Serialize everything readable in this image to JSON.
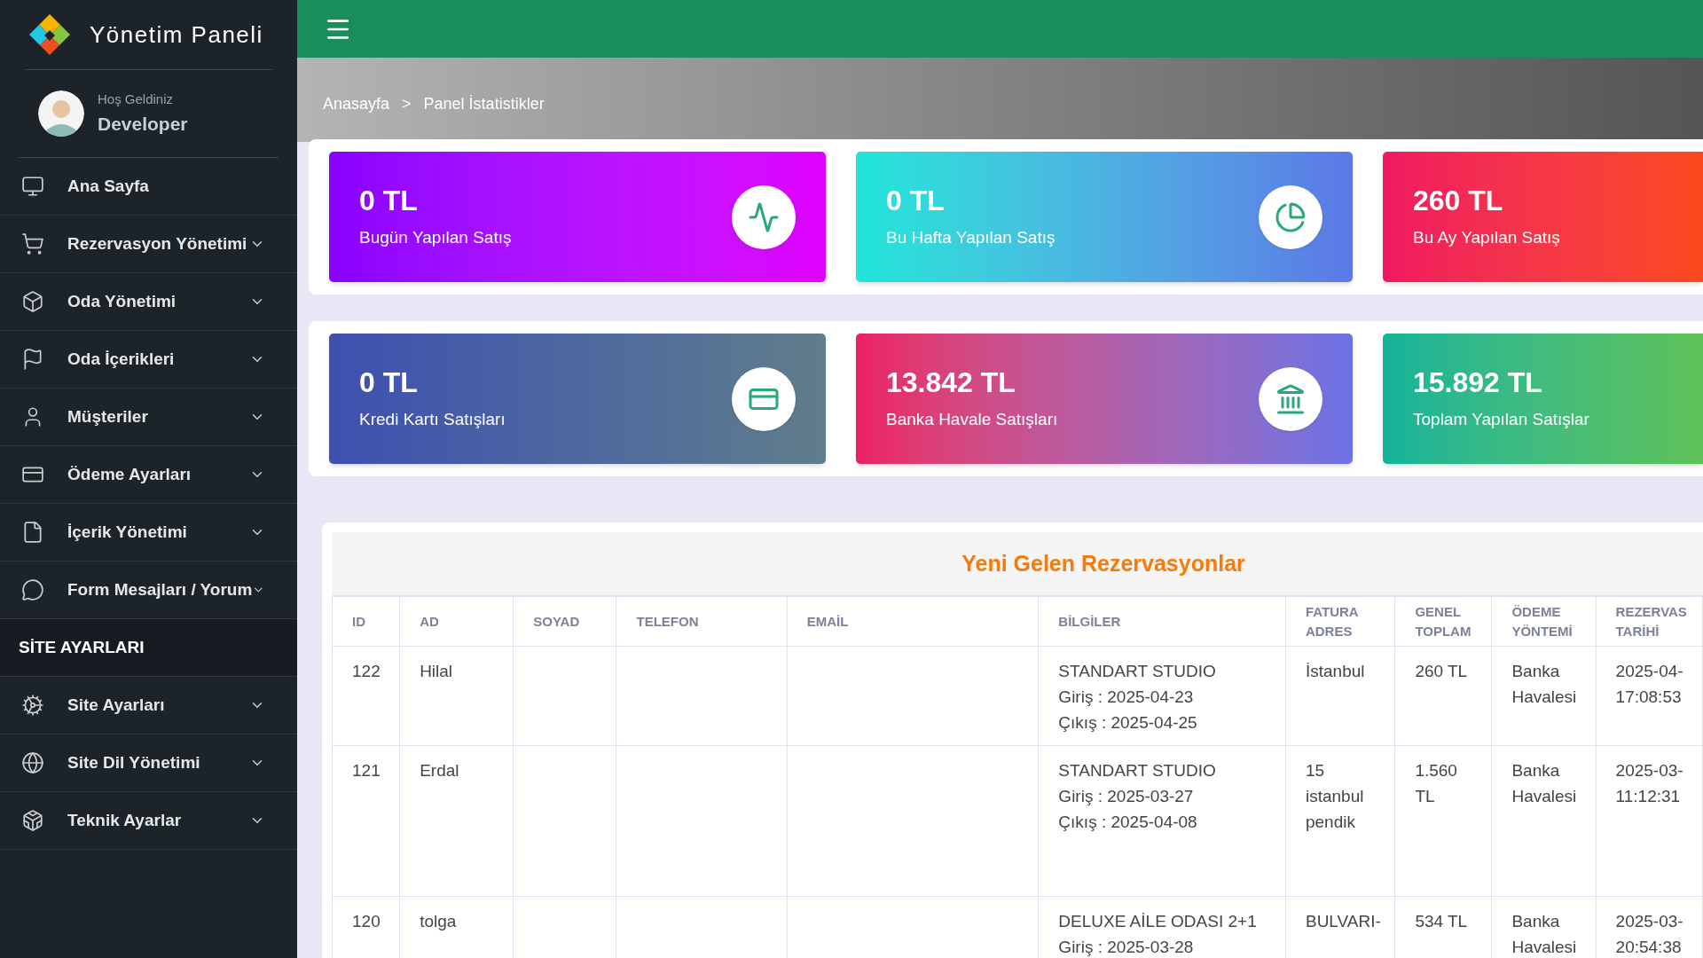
{
  "sidebar": {
    "brand": "Yönetim Paneli",
    "user": {
      "greeting": "Hoş Geldiniz",
      "name": "Developer"
    },
    "items": [
      {
        "label": "Ana Sayfa",
        "has_submenu": false
      },
      {
        "label": "Rezervasyon Yönetimi",
        "has_submenu": true
      },
      {
        "label": "Oda Yönetimi",
        "has_submenu": true
      },
      {
        "label": "Oda İçerikleri",
        "has_submenu": true
      },
      {
        "label": "Müşteriler",
        "has_submenu": true
      },
      {
        "label": "Ödeme Ayarları",
        "has_submenu": true
      },
      {
        "label": "İçerik Yönetimi",
        "has_submenu": true
      },
      {
        "label": "Form Mesajları / Yorum",
        "has_submenu": true
      }
    ],
    "section_heading": "SİTE AYARLARI",
    "settings_items": [
      {
        "label": "Site Ayarları",
        "has_submenu": true
      },
      {
        "label": "Site Dil Yönetimi",
        "has_submenu": true
      },
      {
        "label": "Teknik Ayarlar",
        "has_submenu": true
      }
    ]
  },
  "breadcrumb": [
    "Anasayfa",
    ">",
    "Panel İstatistikler"
  ],
  "stat_rows": [
    [
      {
        "value": "0 TL",
        "label": "Bugün Yapılan Satış"
      },
      {
        "value": "0 TL",
        "label": "Bu Hafta Yapılan Satış"
      },
      {
        "value": "260 TL",
        "label": "Bu Ay Yapılan Satış"
      }
    ],
    [
      {
        "value": "0 TL",
        "label": "Kredi Kartı Satışları"
      },
      {
        "value": "13.842 TL",
        "label": "Banka Havale Satışları"
      },
      {
        "value": "15.892 TL",
        "label": "Toplam Yapılan Satışlar"
      }
    ]
  ],
  "table": {
    "title": "Yeni Gelen Rezervasyonlar",
    "columns": [
      [
        "ID"
      ],
      [
        "AD"
      ],
      [
        "SOYAD"
      ],
      [
        "TELEFON"
      ],
      [
        "EMAİL"
      ],
      [
        "BİLGİLER"
      ],
      [
        "FATURA",
        "ADRES"
      ],
      [
        "GENEL",
        "TOPLAM"
      ],
      [
        "ÖDEME",
        "YÖNTEMİ"
      ],
      [
        "REZERVAS",
        "TARİHİ"
      ]
    ],
    "rows": [
      {
        "id": "122",
        "ad": "Hilal",
        "bilgiler": [
          "STANDART STUDIO",
          "Giriş : 2025-04-23",
          "Çıkış : 2025-04-25"
        ],
        "fatura_adres": [
          "İstanbul"
        ],
        "genel_toplam": [
          "260 TL"
        ],
        "odeme_yontemi": [
          "Banka",
          "Havalesi"
        ],
        "rezervasyon_tarihi": [
          "2025-04-",
          "17:08:53"
        ]
      },
      {
        "id": "121",
        "ad": "Erdal",
        "bilgiler": [
          "STANDART STUDIO",
          "Giriş : 2025-03-27",
          "Çıkış : 2025-04-08"
        ],
        "fatura_adres": [
          "15",
          "istanbul",
          "pendik"
        ],
        "genel_toplam": [
          "1.560",
          "TL"
        ],
        "odeme_yontemi": [
          "Banka",
          "Havalesi"
        ],
        "rezervasyon_tarihi": [
          "2025-03-",
          "11:12:31"
        ]
      },
      {
        "id": "120",
        "ad": "tolga",
        "bilgiler": [
          "DELUXE AİLE ODASI 2+1",
          "Giriş : 2025-03-28"
        ],
        "fatura_adres": [
          "BULVARI-"
        ],
        "genel_toplam": [
          "534 TL"
        ],
        "odeme_yontemi": [
          "Banka",
          "Havalesi"
        ],
        "rezervasyon_tarihi": [
          "2025-03-",
          "20:54:38"
        ]
      }
    ]
  }
}
